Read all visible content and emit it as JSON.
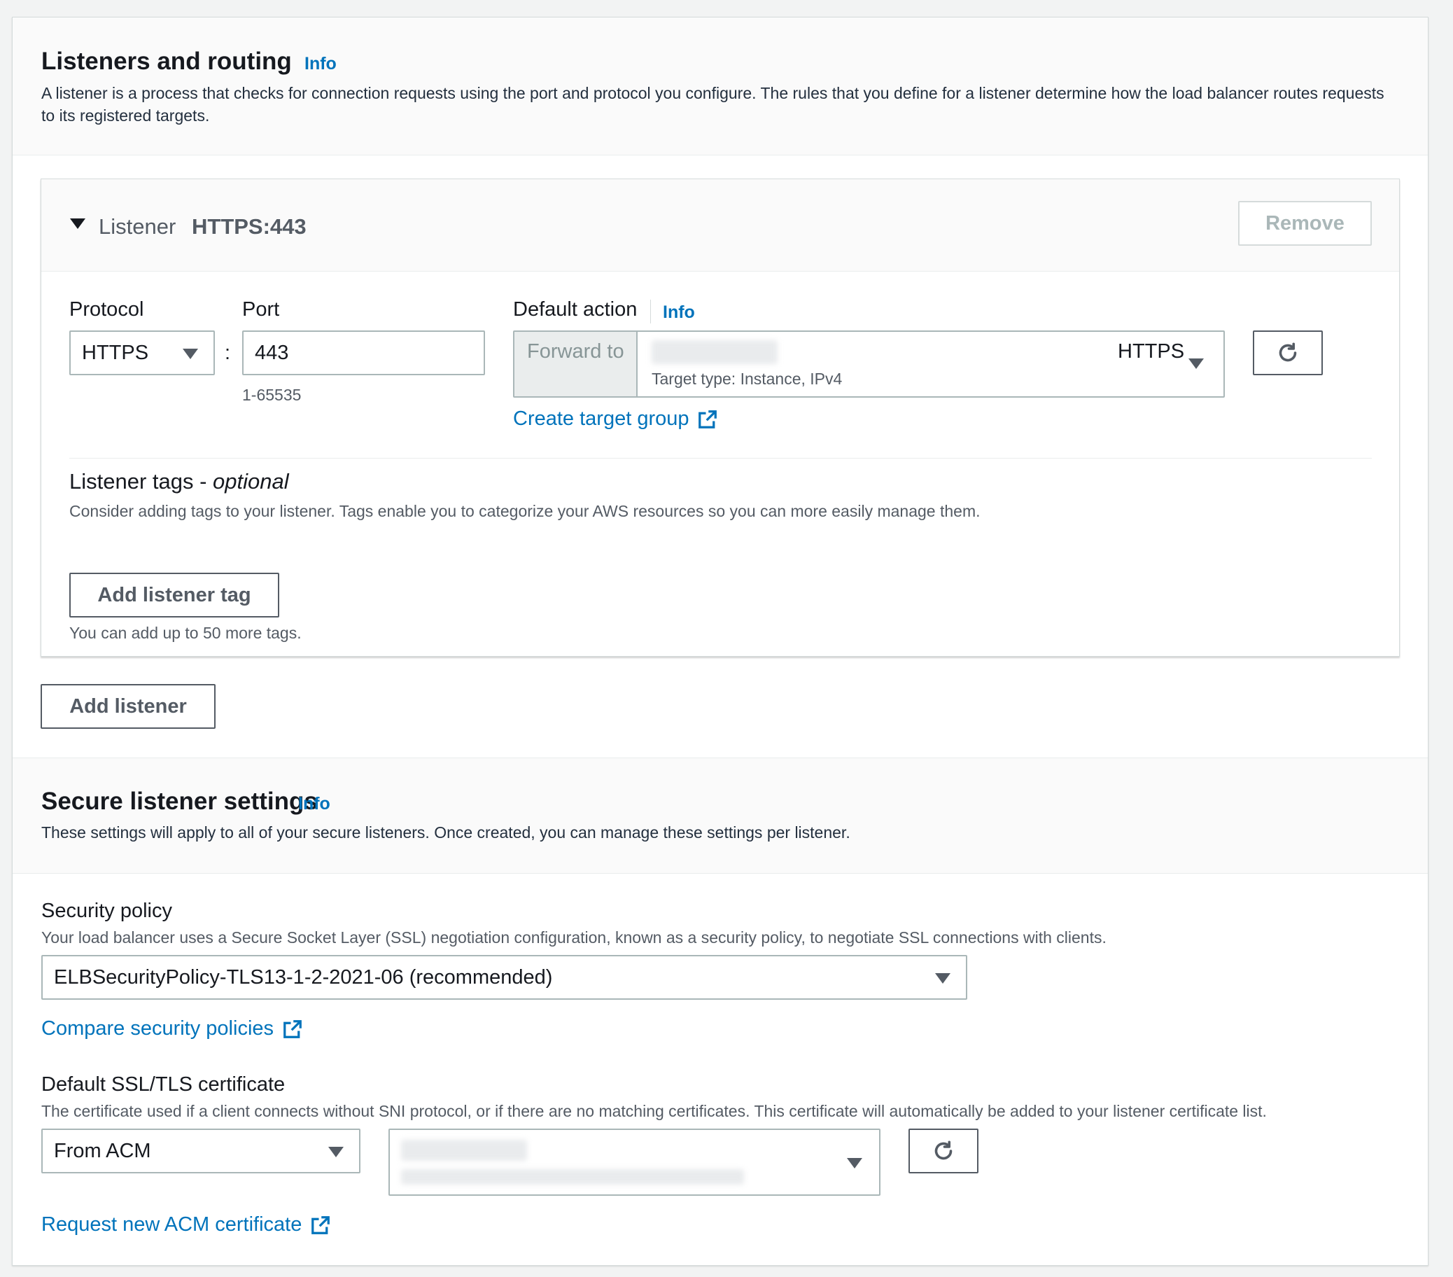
{
  "listeners_section": {
    "title": "Listeners and routing",
    "info": "Info",
    "description": "A listener is a process that checks for connection requests using the port and protocol you configure. The rules that you define for a listener determine how the load balancer routes requests to its registered targets."
  },
  "listener": {
    "prefix": "Listener",
    "name": "HTTPS:443",
    "remove_label": "Remove",
    "protocol_label": "Protocol",
    "protocol_value": "HTTPS",
    "port_label": "Port",
    "port_value": "443",
    "port_hint": "1-65535",
    "separator": ":",
    "default_action_label": "Default action",
    "default_action_info": "Info",
    "forward_to": "Forward to",
    "target_protocol": "HTTPS",
    "target_type": "Target type: Instance, IPv4",
    "create_target_group": "Create target group",
    "tags_title": "Listener tags - ",
    "tags_optional": "optional",
    "tags_description": "Consider adding tags to your listener. Tags enable you to categorize your AWS resources so you can more easily manage them.",
    "add_tag_label": "Add listener tag",
    "tags_hint": "You can add up to 50 more tags."
  },
  "add_listener_label": "Add listener",
  "secure_section": {
    "title": "Secure listener settings",
    "info": "Info",
    "description": "These settings will apply to all of your secure listeners. Once created, you can manage these settings per listener.",
    "policy_label": "Security policy",
    "policy_description": "Your load balancer uses a Secure Socket Layer (SSL) negotiation configuration, known as a security policy, to negotiate SSL connections with clients.",
    "policy_value": "ELBSecurityPolicy-TLS13-1-2-2021-06 (recommended)",
    "compare_link": "Compare security policies",
    "cert_label": "Default SSL/TLS certificate",
    "cert_description": "The certificate used if a client connects without SNI protocol, or if there are no matching certificates. This certificate will automatically be added to your listener certificate list.",
    "cert_source": "From ACM",
    "request_link": "Request new ACM certificate"
  },
  "colors": {
    "link": "#0073bb",
    "border": "#aab7b8",
    "button_border": "#545b64",
    "text": "#16191f"
  }
}
